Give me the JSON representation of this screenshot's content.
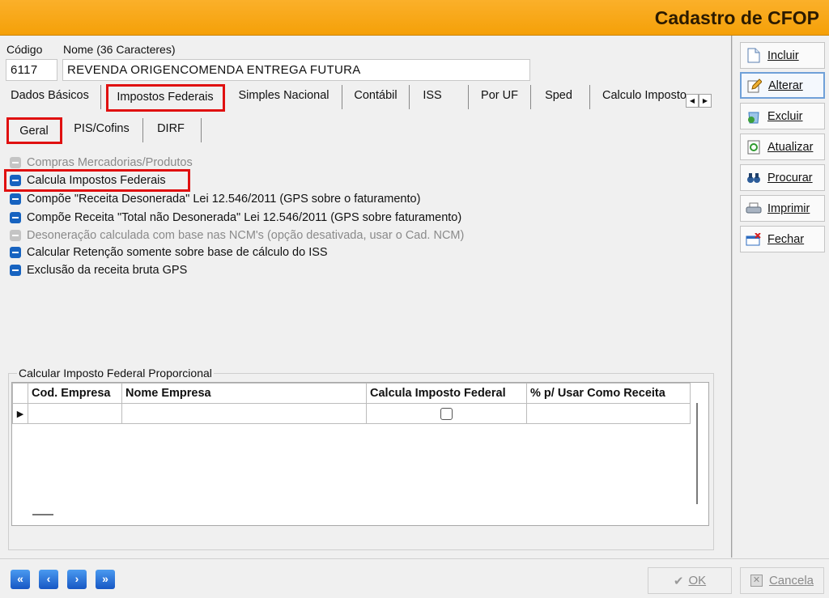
{
  "window": {
    "title": "Cadastro de CFOP"
  },
  "form": {
    "codigo_label": "Código",
    "nome_label": "Nome (36 Caracteres)",
    "codigo_value": "6117",
    "nome_value": "REVENDA ORIGENCOMENDA ENTREGA FUTURA"
  },
  "tabs": [
    "Dados Básicos",
    "Impostos Federais",
    "Simples Nacional",
    "Contábil",
    "ISS",
    "Por UF",
    "Sped",
    "Calculo Imposto"
  ],
  "subtabs": [
    "Geral",
    "PIS/Cofins",
    "DIRF"
  ],
  "options": [
    {
      "label": "Compras Mercadorias/Produtos",
      "checked": true,
      "enabled": false
    },
    {
      "label": "Calcula Impostos Federais",
      "checked": true,
      "enabled": true
    },
    {
      "label": "Compõe \"Receita Desonerada\" Lei 12.546/2011 (GPS sobre o faturamento)",
      "checked": true,
      "enabled": true
    },
    {
      "label": "Compõe Receita \"Total não Desonerada\" Lei 12.546/2011 (GPS sobre faturamento)",
      "checked": true,
      "enabled": true
    },
    {
      "label": "Desoneração calculada com base nas NCM's (opção desativada, usar o Cad. NCM)",
      "checked": true,
      "enabled": false
    },
    {
      "label": "Calcular Retenção somente sobre base de cálculo do ISS",
      "checked": true,
      "enabled": true
    },
    {
      "label": "Exclusão da receita bruta GPS",
      "checked": true,
      "enabled": true
    }
  ],
  "group": {
    "label": "Calcular Imposto Federal Proporcional",
    "columns": [
      "Cod. Empresa",
      "Nome Empresa",
      "Calcula Imposto Federal",
      "% p/ Usar Como Receita"
    ]
  },
  "sidebar": {
    "buttons": [
      {
        "label": "Incluir",
        "icon": "document-icon"
      },
      {
        "label": "Alterar",
        "icon": "edit-icon"
      },
      {
        "label": "Excluir",
        "icon": "delete-icon"
      },
      {
        "label": "Atualizar",
        "icon": "refresh-icon"
      },
      {
        "label": "Procurar",
        "icon": "binoculars-icon"
      },
      {
        "label": "Imprimir",
        "icon": "printer-icon"
      },
      {
        "label": "Fechar",
        "icon": "close-window-icon"
      }
    ]
  },
  "footer": {
    "nav": [
      "«",
      "‹",
      "›",
      "»"
    ],
    "ok_label": "OK",
    "cancel_label": "Cancela"
  },
  "colors": {
    "titlebar": "#f5a008",
    "highlight": "#e01010",
    "checkbox": "#1763c0"
  }
}
